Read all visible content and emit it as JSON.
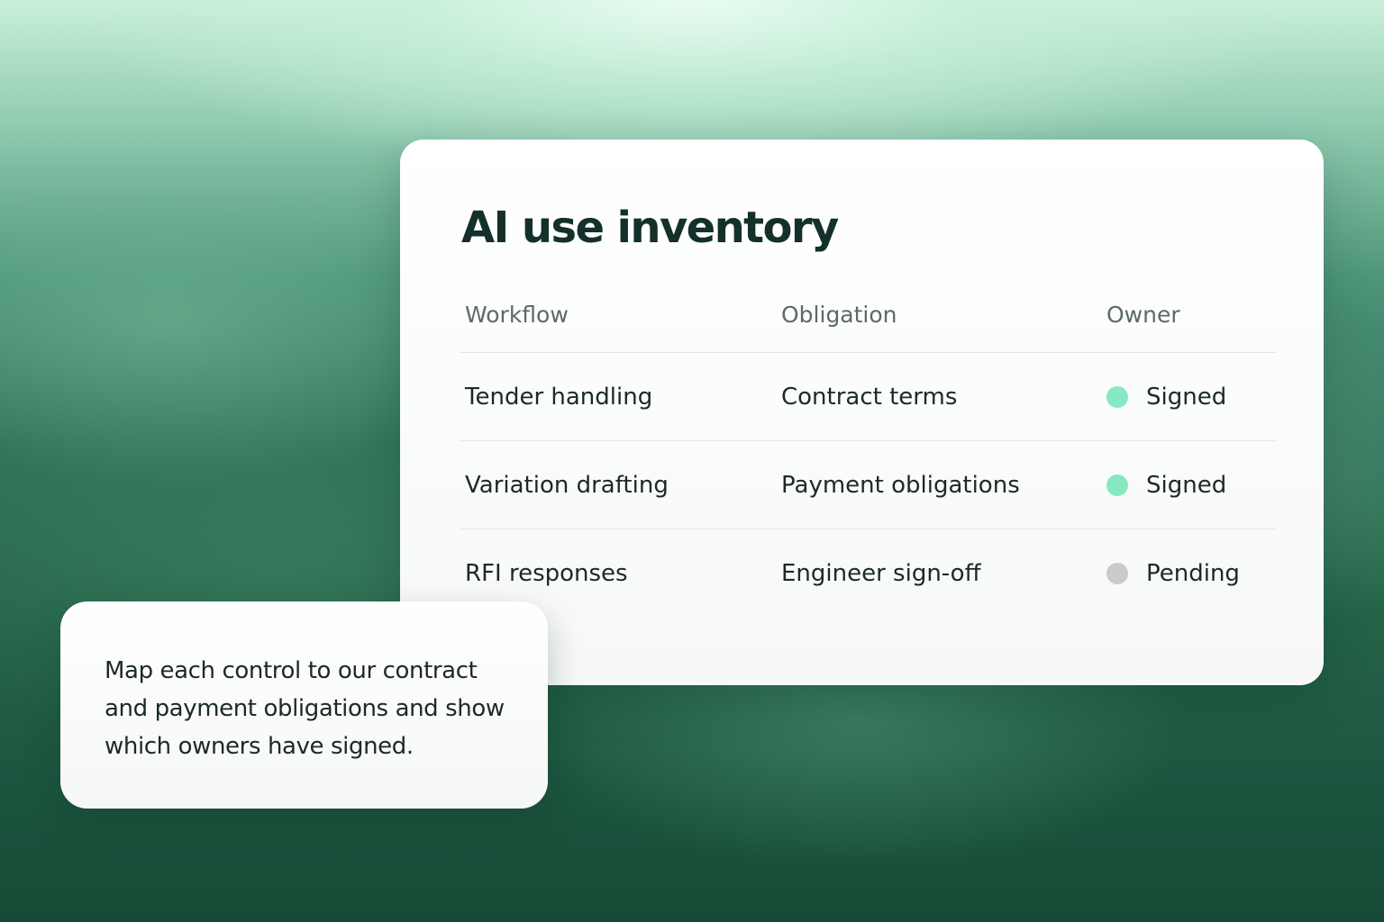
{
  "inventory": {
    "title": "AI use inventory",
    "columns": [
      "Workflow",
      "Obligation",
      "Owner"
    ],
    "rows": [
      {
        "workflow": "Tender handling",
        "obligation": "Contract terms",
        "owner_status": "Signed",
        "status_color": "#86e9c1"
      },
      {
        "workflow": "Variation drafting",
        "obligation": "Payment obligations",
        "owner_status": "Signed",
        "status_color": "#86e9c1"
      },
      {
        "workflow": "RFI responses",
        "obligation": "Engineer sign-off",
        "owner_status": "Pending",
        "status_color": "#c9cccb"
      }
    ]
  },
  "prompt": {
    "text": "Map each control to our contract and payment obligations and show which owners have signed."
  },
  "colors": {
    "signed": "#86e9c1",
    "pending": "#c9cccb",
    "title_text": "#14302a",
    "background_green": "#256449"
  }
}
